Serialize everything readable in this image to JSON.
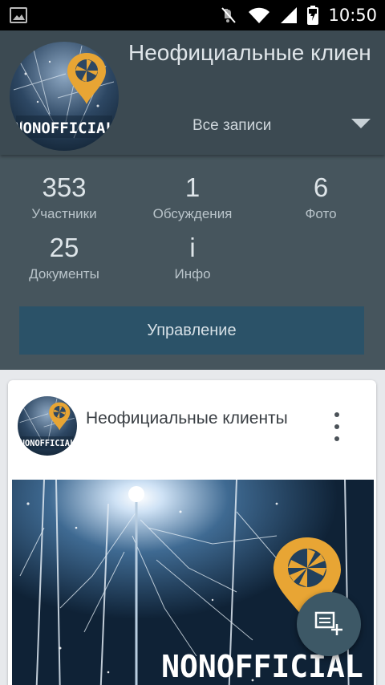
{
  "status_bar": {
    "time": "10:50",
    "icons": [
      "image-icon",
      "mute-icon",
      "wifi-icon",
      "signal-icon",
      "battery-icon"
    ]
  },
  "header": {
    "title": "Неофициальные клиен",
    "filter_label": "Все записи",
    "avatar_logo_text": "NONOFFICIAL"
  },
  "stats": {
    "items": [
      {
        "value": "353",
        "label": "Участники"
      },
      {
        "value": "1",
        "label": "Обсуждения"
      },
      {
        "value": "6",
        "label": "Фото"
      },
      {
        "value": "25",
        "label": "Документы"
      },
      {
        "value": "i",
        "label": "Инфо"
      }
    ],
    "manage_label": "Управление"
  },
  "post": {
    "author": "Неофициальные клиенты",
    "image_logo_text": "NONOFFICIAL"
  },
  "colors": {
    "header_bg": "#3c4a52",
    "stats_bg": "#46555d",
    "button_bg": "#2b5268",
    "fab_bg": "#3d5866",
    "accent_orange": "#e8a534"
  }
}
